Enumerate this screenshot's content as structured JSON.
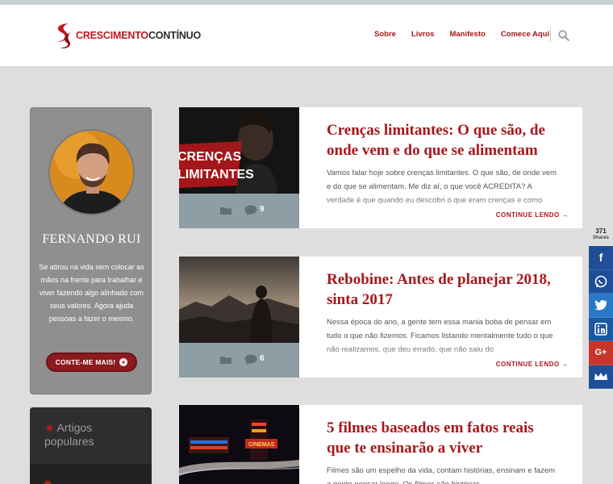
{
  "brand": {
    "name_part1": "CRESCIMENTO",
    "name_part2": "CONTÍNUO",
    "accent": "#a8171b"
  },
  "nav": {
    "items": [
      "Sobre",
      "Livros",
      "Manifesto",
      "Comece Aqui"
    ]
  },
  "profile": {
    "name": "FERNANDO RUI",
    "bio": "Se atirou na vida sem colocar as mãos na frente para trabalhar e viver fazendo algo alinhado com seus valores. Agora ajuda pessoas a fazer o mesmo.",
    "button_label": "CONTE-ME MAIS!"
  },
  "popular": {
    "title": "Artigos populares"
  },
  "posts": [
    {
      "title": "Crenças limitantes: O que são, de onde vem e do que se alimentam",
      "image_text": [
        "CRENÇAS",
        "LIMITANTES"
      ],
      "excerpt": "Vamos falar hoje sobre crenças limitantes. O que são, de onde vem e do que se alimentam. Me diz aí, o que você ACREDITA? A verdade é que quando eu descobri o que eram crenças e como",
      "comments": "9",
      "continue_label": "CONTINUE LENDO →"
    },
    {
      "title": "Rebobine: Antes de planejar 2018, sinta 2017",
      "excerpt": "Nessa época do ano, a gente tem essa mania boba de pensar em tudo o que não fizemos. Ficamos listando mentalmente tudo o que não realizamos, que deu errado, que não saiu do",
      "comments": "6",
      "continue_label": "CONTINUE LENDO →"
    },
    {
      "title": "5 filmes baseados em fatos reais que te ensinarão a viver",
      "excerpt": "Filmes são um espelho da vida, contam histórias, ensinam e fazem a gente pensar longe. Os filmes são histórias",
      "image_text": [
        "CINEMAS"
      ]
    }
  ],
  "share": {
    "count": "371",
    "label": "Shares",
    "buttons": [
      "facebook-icon",
      "whatsapp-icon",
      "twitter-icon",
      "linkedin-icon",
      "google-plus-icon",
      "sumo-icon"
    ]
  }
}
